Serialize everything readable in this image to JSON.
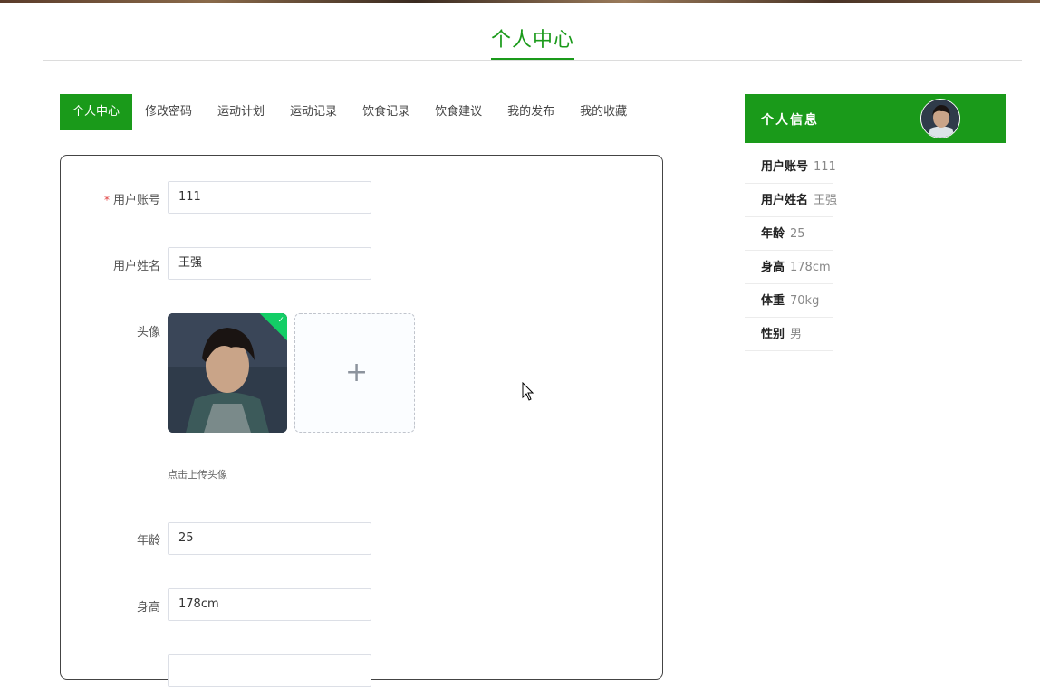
{
  "page": {
    "title": "个人中心"
  },
  "tabs": [
    {
      "label": "个人中心",
      "active": true
    },
    {
      "label": "修改密码"
    },
    {
      "label": "运动计划"
    },
    {
      "label": "运动记录"
    },
    {
      "label": "饮食记录"
    },
    {
      "label": "饮食建议"
    },
    {
      "label": "我的发布"
    },
    {
      "label": "我的收藏"
    }
  ],
  "form": {
    "account": {
      "required_mark": "*",
      "label": "用户账号",
      "value": "111"
    },
    "name": {
      "label": "用户姓名",
      "value": "王强"
    },
    "avatar": {
      "label": "头像",
      "hint": "点击上传头像",
      "add_glyph": "+",
      "success_glyph": "✓"
    },
    "age": {
      "label": "年龄",
      "value": "25"
    },
    "height": {
      "label": "身高",
      "value": "178cm"
    }
  },
  "info_panel": {
    "title": "个人信息",
    "items": [
      {
        "key": "用户账号",
        "value": "111"
      },
      {
        "key": "用户姓名",
        "value": "王强"
      },
      {
        "key": "年龄",
        "value": "25"
      },
      {
        "key": "身高",
        "value": "178cm"
      },
      {
        "key": "体重",
        "value": "70kg"
      },
      {
        "key": "性别",
        "value": "男"
      }
    ]
  },
  "colors": {
    "accent": "#1a9a1a",
    "success": "#13ce66"
  }
}
